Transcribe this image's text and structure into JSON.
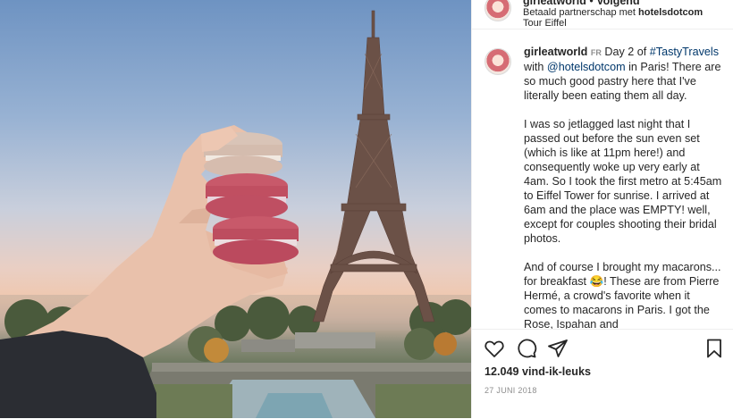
{
  "post": {
    "photo_alt": "Hand holding three macarons in front of the Eiffel Tower at sunrise"
  },
  "header": {
    "username": "girleatworld",
    "separator": "•",
    "follow_label": "Volgend",
    "partnership_prefix": "Betaald partnerschap met",
    "partner": "hotelsdotcom",
    "location": "Tour Eiffel",
    "more_label": "•••"
  },
  "caption": {
    "username": "girleatworld",
    "country": "FR",
    "p1_before": "Day 2 of",
    "hashtag": "#TastyTravels",
    "p1_mid": "with",
    "mention": "@hotelsdotcom",
    "p1_after": "in Paris! There are so much good pastry here that I've literally been eating them all day.",
    "p2": "I was so jetlagged last night that I passed out before the sun even set (which is like at 11pm here!) and consequently woke up very early at 4am. So I took the first metro at 5:45am to Eiffel Tower for sunrise. I arrived at 6am and the place was EMPTY! well, except for couples shooting their bridal photos.",
    "p3_before": "And of course I brought my macarons... for breakfast",
    "emoji": "😂",
    "p3_after": "! These are from Pierre Hermé, a crowd's favorite when it comes to macarons in Paris. I got the Rose, Ispahan and"
  },
  "actions": {
    "like_icon": "heart-icon",
    "comment_icon": "comment-icon",
    "share_icon": "share-icon",
    "save_icon": "bookmark-icon"
  },
  "likes": "12.049 vind-ik-leuks",
  "date": "27 JUNI 2018"
}
